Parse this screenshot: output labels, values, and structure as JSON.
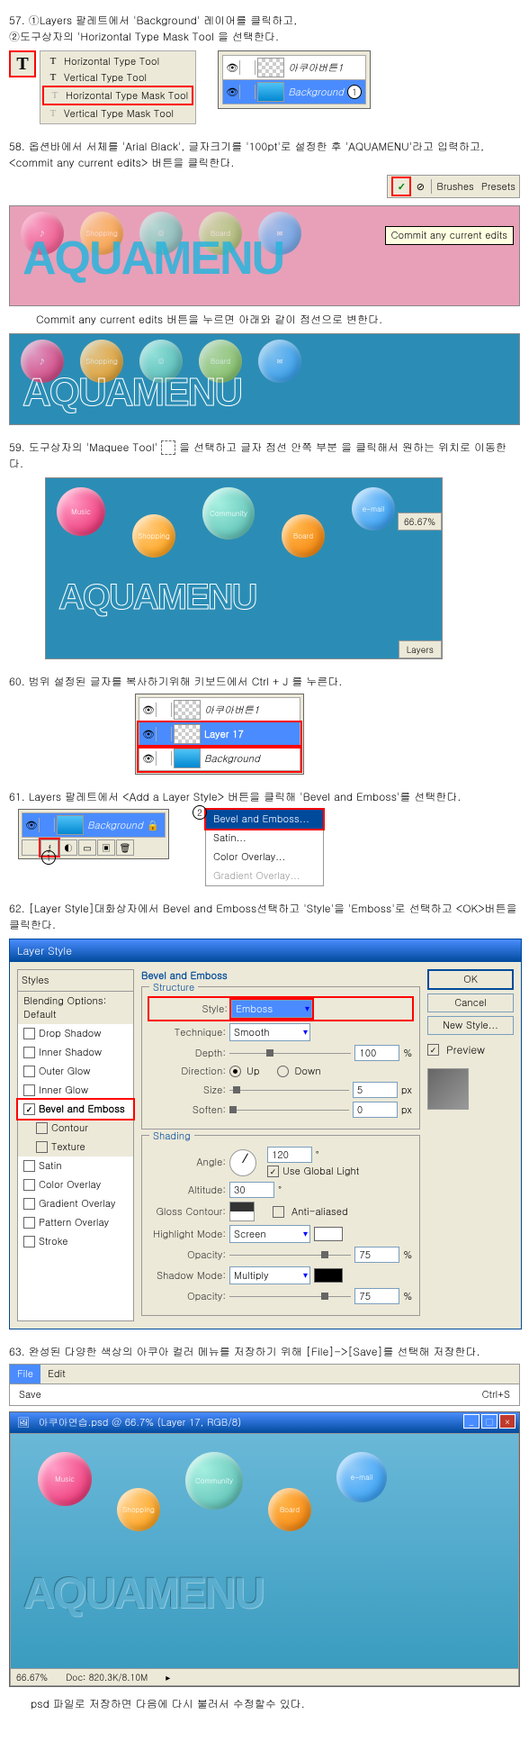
{
  "s57": {
    "text": "57. ①Layers 팔레트에서 'Background' 레이어를 클릭하고,\n        ②도구상자의 'Horizontal Type Mask Tool 을 선택한다.",
    "tools": [
      "Horizontal Type Tool",
      "Vertical Type Tool",
      "Horizontal Type Mask Tool",
      "Vertical Type Mask Tool"
    ],
    "layer1": "아쿠아버튼1",
    "layer2": "Background"
  },
  "s58": {
    "text": "58.  옵션바에서 서체를 'Arial Black', 글자크기를 '100pt'로 설정한 후 'AQUAMENU'라고 입력하고,  <commit any current edits> 버튼을 클릭한다.",
    "bar_tabs": [
      "Brushes",
      "Presets"
    ],
    "tooltip": "Commit any current edits",
    "aqua_text": "AQUAMENU",
    "after": "Commit any current edits 버튼을 누르면 아래와 같이 점선으로 변한다.",
    "bubble_shopping": "Shopping",
    "bubble_board": "Board"
  },
  "s59": {
    "text1": "59.  도구상자의 'Maquee Tool' ",
    "text2": " 을 선택하고 글자 점선 안쪽 부분 을 클릭해서 원하는 위치로 이동한다.",
    "zoom": "66.67%",
    "layers_tab": "Layers",
    "bubble_music": "Music",
    "bubble_community": "Community",
    "bubble_email": "e-mail",
    "bubble_shopping": "Shopping",
    "bubble_board": "Board",
    "aqua": "AQUAMENU"
  },
  "s60": {
    "text": "60.  범위 설정된 글자를 복사하기위해 키보드에서 Ctrl + J 를 누른다.",
    "layer1": "아쿠아버튼1",
    "layer2": "Layer 17",
    "layer3": "Background"
  },
  "s61": {
    "text": "61.  Layers 팔레트에서 <Add a Layer Style> 버튼을 클릭해 'Bevel and  Emboss'를 선택한다.",
    "bg": "Background",
    "menu": [
      "Bevel and Emboss...",
      "Satin...",
      "Color Overlay...",
      "Gradient Overlay..."
    ]
  },
  "s62": {
    "text": "62. [Layer Style]대화상자에서 Bevel and Emboss선택하고 'Style'을 'Emboss'로 선택하고 <OK>버튼을 클릭한다.",
    "dlg_title": "Layer Style",
    "styles_header": "Styles",
    "blending": "Blending Options: Default",
    "list": [
      "Drop Shadow",
      "Inner Shadow",
      "Outer Glow",
      "Inner Glow",
      "Bevel and Emboss",
      "Contour",
      "Texture",
      "Satin",
      "Color Overlay",
      "Gradient Overlay",
      "Pattern Overlay",
      "Stroke"
    ],
    "structure_title": "Bevel and Emboss",
    "section1": "Structure",
    "style_lbl": "Style:",
    "style_val": "Emboss",
    "tech_lbl": "Technique:",
    "tech_val": "Smooth",
    "depth_lbl": "Depth:",
    "depth_val": "100",
    "pct": "%",
    "dir_lbl": "Direction:",
    "dir_up": "Up",
    "dir_down": "Down",
    "size_lbl": "Size:",
    "size_val": "5",
    "px": "px",
    "soften_lbl": "Soften:",
    "soften_val": "0",
    "section2": "Shading",
    "angle_lbl": "Angle:",
    "angle_val": "120",
    "global": "Use Global Light",
    "alt_lbl": "Altitude:",
    "alt_val": "30",
    "gloss_lbl": "Gloss Contour:",
    "aa": "Anti-aliased",
    "hl_mode_lbl": "Highlight Mode:",
    "hl_mode_val": "Screen",
    "opacity_lbl": "Opacity:",
    "hl_op_val": "75",
    "sh_mode_lbl": "Shadow Mode:",
    "sh_mode_val": "Multiply",
    "sh_op_val": "75",
    "ok": "OK",
    "cancel": "Cancel",
    "new_style": "New Style...",
    "preview": "Preview"
  },
  "s63": {
    "text": "63.  완성된 다양한 색상의 아쿠아 컬러 메뉴를 저장하기 위해 [File]->[Save]를 선택해 저장한다.",
    "menu_file": "File",
    "menu_edit": "Edit",
    "save": "Save",
    "shortcut": "Ctrl+S",
    "win_title": "아쿠아연습.psd @ 66.7% (Layer 17, RGB/8)",
    "aqua": "AQUAMENU",
    "bubble_music": "Music",
    "bubble_community": "Community",
    "bubble_email": "e-mail",
    "bubble_shopping": "Shopping",
    "bubble_board": "Board",
    "status_zoom": "66.67%",
    "status_doc": "Doc: 820.3K/8.10M",
    "footer": "psd 파일로 저장하면 다음에 다시 불러서 수정할수 있다."
  }
}
